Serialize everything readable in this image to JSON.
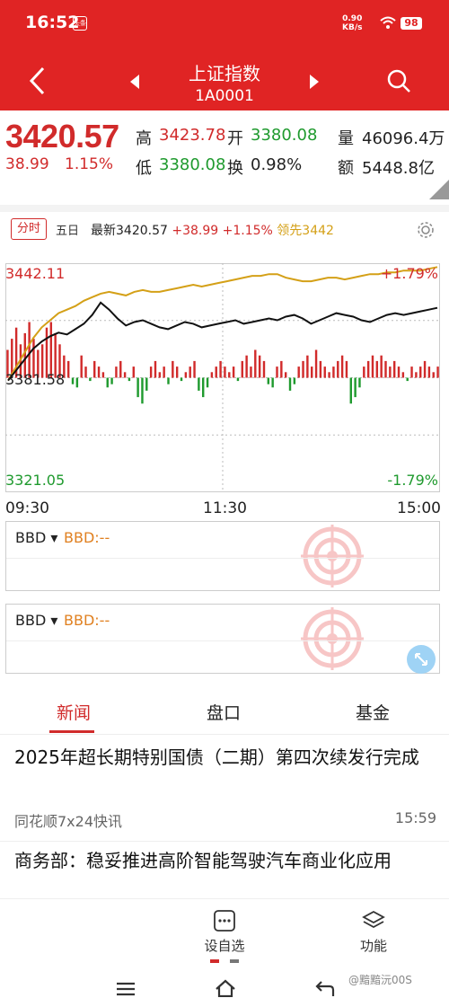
{
  "status": {
    "time": "16:52",
    "app_badge": "头条",
    "net_speed_top": "0.90",
    "net_speed_bottom": "KB/s",
    "battery": "98"
  },
  "header": {
    "title": "上证指数",
    "code": "1A0001"
  },
  "quote": {
    "price": "3420.57",
    "change": "38.99",
    "change_pct": "1.15%",
    "high_label": "高",
    "high": "3423.78",
    "open_label": "开",
    "open": "3380.08",
    "volume_label": "量",
    "volume": "46096.4万",
    "low_label": "低",
    "low": "3380.08",
    "turnover_label": "换",
    "turnover": "0.98%",
    "amount_label": "额",
    "amount": "5448.8亿"
  },
  "tabs": {
    "intraday": "分时",
    "five_day": "五日",
    "latest": "最新3420.57",
    "latest_change": "+38.99",
    "latest_pct": "+1.15%",
    "lead": "领先3442"
  },
  "chart_data": {
    "type": "line",
    "y_top": "3442.11",
    "y_mid": "3381.58",
    "y_bottom": "3321.05",
    "pct_top": "+1.79%",
    "pct_bottom": "-1.79%",
    "ylim": [
      3321.05,
      3442.11
    ],
    "x_ticks": [
      "09:30",
      "11:30",
      "15:00"
    ],
    "series": [
      {
        "name": "最新",
        "color": "#111111",
        "values": [
          3380,
          3386,
          3392,
          3398,
          3402,
          3405,
          3407,
          3406,
          3409,
          3412,
          3417,
          3424,
          3420,
          3415,
          3411,
          3413,
          3414,
          3412,
          3410,
          3409,
          3411,
          3413,
          3412,
          3410,
          3411,
          3412,
          3413,
          3414,
          3412,
          3413,
          3414,
          3415,
          3414,
          3416,
          3417,
          3415,
          3412,
          3414,
          3416,
          3418,
          3417,
          3416,
          3414,
          3413,
          3415,
          3417,
          3418,
          3417,
          3418,
          3419,
          3420,
          3421
        ]
      },
      {
        "name": "领先",
        "color": "#d4a017",
        "values": [
          3380,
          3388,
          3396,
          3404,
          3410,
          3414,
          3418,
          3420,
          3422,
          3425,
          3427,
          3429,
          3430,
          3429,
          3428,
          3430,
          3431,
          3430,
          3430,
          3431,
          3432,
          3433,
          3434,
          3433,
          3434,
          3435,
          3436,
          3437,
          3438,
          3439,
          3439,
          3440,
          3440,
          3438,
          3437,
          3436,
          3436,
          3437,
          3438,
          3438,
          3437,
          3438,
          3439,
          3440,
          3440,
          3441,
          3441,
          3442,
          3442,
          3442,
          3443,
          3444
        ]
      }
    ],
    "volume_bars": [
      0.5,
      0.7,
      0.9,
      0.6,
      0.8,
      1.0,
      0.7,
      0.5,
      0.6,
      0.9,
      1.0,
      0.8,
      0.6,
      0.4,
      0.3,
      -0.2,
      -0.3,
      0.4,
      0.2,
      -0.1,
      0.3,
      0.2,
      0.1,
      -0.3,
      -0.2,
      0.2,
      0.3,
      0.1,
      -0.1,
      0.2,
      -0.6,
      -0.8,
      -0.4,
      0.2,
      0.3,
      0.1,
      0.2,
      -0.2,
      0.3,
      0.2,
      -0.1,
      0.1,
      0.2,
      0.3,
      -0.4,
      -0.6,
      -0.3,
      0.1,
      0.2,
      0.3,
      0.2,
      0.1,
      0.2,
      -0.1,
      0.3,
      0.4,
      0.2,
      0.5,
      0.4,
      0.3,
      -0.2,
      -0.3,
      0.2,
      0.3,
      0.1,
      -0.4,
      -0.2,
      0.2,
      0.3,
      0.4,
      0.2,
      0.5,
      0.3,
      0.2,
      0.1,
      0.2,
      0.3,
      0.4,
      0.3,
      -0.8,
      -0.6,
      -0.3,
      0.2,
      0.3,
      0.4,
      0.3,
      0.4,
      0.3,
      0.2,
      0.3,
      0.2,
      0.1,
      -0.1,
      0.2,
      0.1,
      0.2,
      0.3,
      0.2,
      0.1,
      0.2
    ]
  },
  "panels": [
    {
      "selector": "BBD",
      "value": "BBD:--"
    },
    {
      "selector": "BBD",
      "value": "BBD:--"
    }
  ],
  "news_tabs": [
    "新闻",
    "盘口",
    "基金"
  ],
  "news": [
    {
      "title": "2025年超长期特别国债（二期）第四次续发行完成",
      "source": "同花顺7x24快讯",
      "time": "15:59"
    },
    {
      "title": "商务部：稳妥推进高阶智能驾驶汽车商业化应用",
      "source": "",
      "time": ""
    }
  ],
  "bottom": {
    "watchlist": "设自选",
    "functions": "功能"
  },
  "watermark": "@黯黯沅00S",
  "colors": {
    "brand": "#e02424",
    "up": "#d12b2b",
    "down": "#1f9a2e",
    "lead_line": "#d4a017"
  }
}
